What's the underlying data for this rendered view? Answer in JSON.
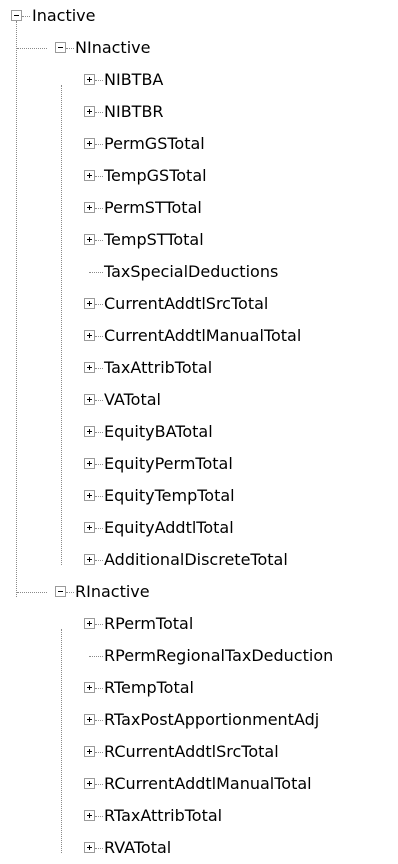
{
  "tree": {
    "root": {
      "label": "Inactive",
      "expanded": true
    },
    "groups": [
      {
        "label": "NInactive",
        "expanded": true,
        "children": [
          {
            "label": "NIBTBA",
            "has_children": true
          },
          {
            "label": "NIBTBR",
            "has_children": true
          },
          {
            "label": "PermGSTotal",
            "has_children": true
          },
          {
            "label": "TempGSTotal",
            "has_children": true
          },
          {
            "label": "PermSTTotal",
            "has_children": true
          },
          {
            "label": "TempSTTotal",
            "has_children": true
          },
          {
            "label": "TaxSpecialDeductions",
            "has_children": false
          },
          {
            "label": "CurrentAddtlSrcTotal",
            "has_children": true
          },
          {
            "label": "CurrentAddtlManualTotal",
            "has_children": true
          },
          {
            "label": "TaxAttribTotal",
            "has_children": true
          },
          {
            "label": "VATotal",
            "has_children": true
          },
          {
            "label": "EquityBATotal",
            "has_children": true
          },
          {
            "label": "EquityPermTotal",
            "has_children": true
          },
          {
            "label": "EquityTempTotal",
            "has_children": true
          },
          {
            "label": "EquityAddtlTotal",
            "has_children": true
          },
          {
            "label": "AdditionalDiscreteTotal",
            "has_children": true
          }
        ]
      },
      {
        "label": "RInactive",
        "expanded": true,
        "children": [
          {
            "label": "RPermTotal",
            "has_children": true
          },
          {
            "label": "RPermRegionalTaxDeduction",
            "has_children": false
          },
          {
            "label": "RTempTotal",
            "has_children": true
          },
          {
            "label": "RTaxPostApportionmentAdj",
            "has_children": true
          },
          {
            "label": "RCurrentAddtlSrcTotal",
            "has_children": true
          },
          {
            "label": "RCurrentAddtlManualTotal",
            "has_children": true
          },
          {
            "label": "RTaxAttribTotal",
            "has_children": true
          },
          {
            "label": "RVATotal",
            "has_children": true
          }
        ]
      }
    ]
  }
}
